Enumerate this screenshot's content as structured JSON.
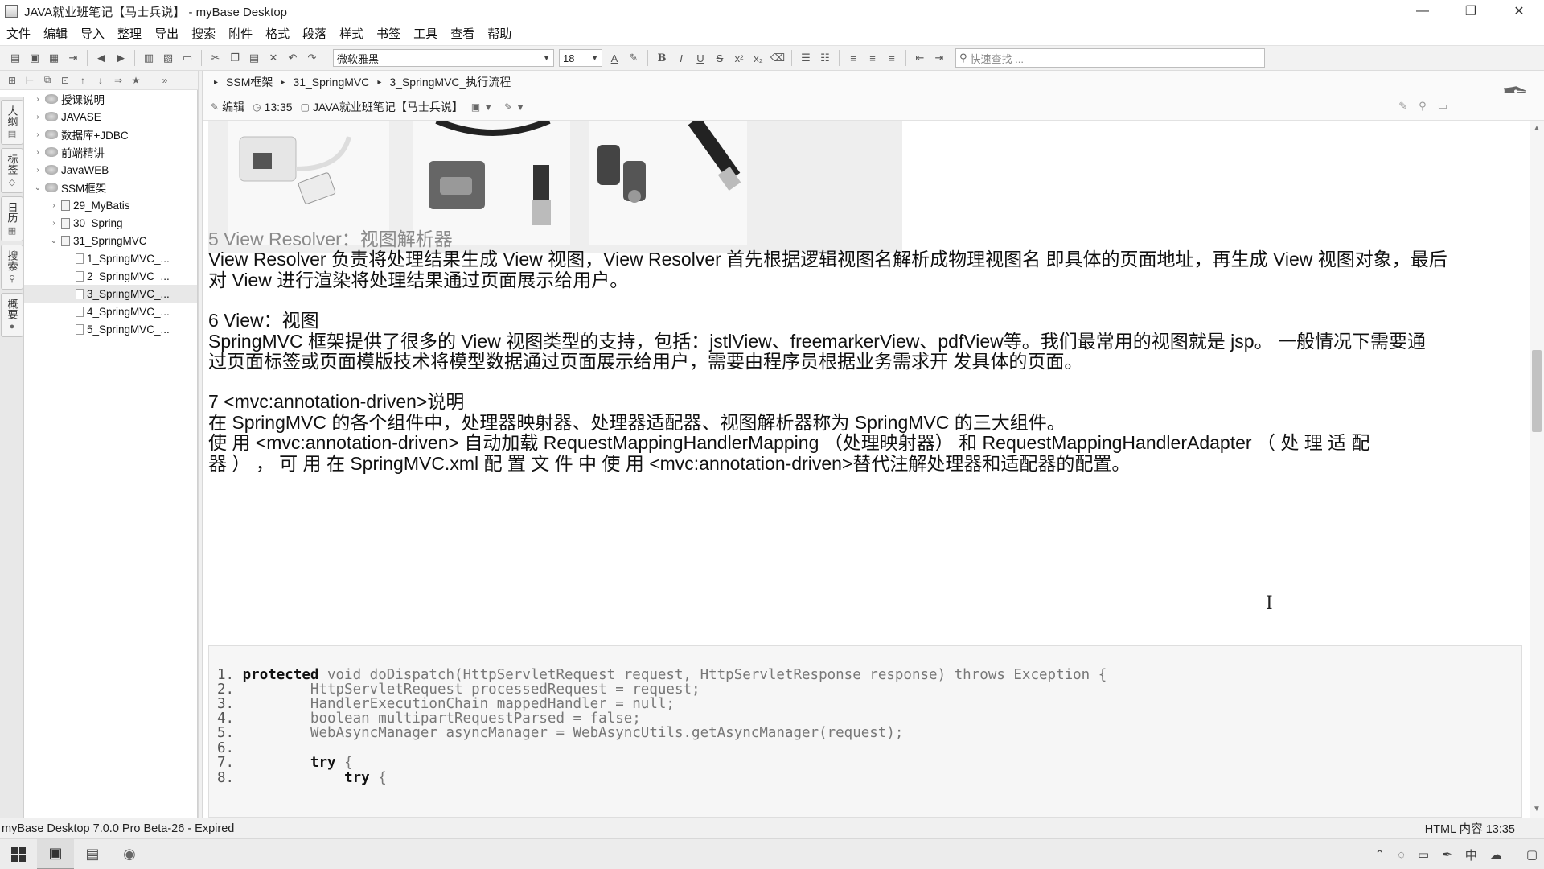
{
  "window": {
    "title": "JAVA就业班笔记【马士兵说】 - myBase Desktop",
    "controls": {
      "minimize": "—",
      "maximize": "❐",
      "close": "✕"
    }
  },
  "menubar": [
    "文件",
    "编辑",
    "导入",
    "整理",
    "导出",
    "搜索",
    "附件",
    "格式",
    "段落",
    "样式",
    "书签",
    "工具",
    "查看",
    "帮助"
  ],
  "toolbar": {
    "font_name": "微软雅黑",
    "font_size": "18",
    "search_placeholder": "快速查找 ..."
  },
  "vertical_tabs": [
    "大纲",
    "标签",
    "日历",
    "搜索",
    "概要"
  ],
  "tree": {
    "nodes": [
      {
        "label": "授课说明",
        "level": 0,
        "expanded": false,
        "icon": "database-icon"
      },
      {
        "label": "JAVASE",
        "level": 0,
        "expanded": false,
        "icon": "database-icon"
      },
      {
        "label": "数据库+JDBC",
        "level": 0,
        "expanded": false,
        "icon": "database-icon"
      },
      {
        "label": "前端精讲",
        "level": 0,
        "expanded": false,
        "icon": "database-icon"
      },
      {
        "label": "JavaWEB",
        "level": 0,
        "expanded": false,
        "icon": "database-icon"
      },
      {
        "label": "SSM框架",
        "level": 0,
        "expanded": true,
        "icon": "database-icon"
      },
      {
        "label": "29_MyBatis",
        "level": 1,
        "expanded": false,
        "icon": "book-icon"
      },
      {
        "label": "30_Spring",
        "level": 1,
        "expanded": false,
        "icon": "book-icon"
      },
      {
        "label": "31_SpringMVC",
        "level": 1,
        "expanded": true,
        "icon": "book-icon"
      },
      {
        "label": "1_SpringMVC_...",
        "level": 2,
        "icon": "page-icon"
      },
      {
        "label": "2_SpringMVC_...",
        "level": 2,
        "icon": "page-icon"
      },
      {
        "label": "3_SpringMVC_...",
        "level": 2,
        "icon": "page-icon",
        "selected": true
      },
      {
        "label": "4_SpringMVC_...",
        "level": 2,
        "icon": "page-icon"
      },
      {
        "label": "5_SpringMVC_...",
        "level": 2,
        "icon": "page-icon"
      }
    ]
  },
  "breadcrumb": [
    "SSM框架",
    "31_SpringMVC",
    "3_SpringMVC_执行流程"
  ],
  "infobar": {
    "mode": "编辑",
    "time": "13:35",
    "database": "JAVA就业班笔记【马士兵说】"
  },
  "content": {
    "s5_heading": "5 View Resolver：视图解析器",
    "s5_body_1": "View Resolver 负责将处理结果生成 View 视图，View Resolver 首先根据逻辑视图名解析成物理视图名 即具体的页面地址，再生成 View 视图对象，最后",
    "s5_body_2": "对 View 进行渲染将处理结果通过页面展示给用户。",
    "s6_heading": "6 View：视图",
    "s6_body_1": "SpringMVC 框架提供了很多的 View 视图类型的支持，包括：jstlView、freemarkerView、pdfView等。我们最常用的视图就是 jsp。 一般情况下需要通",
    "s6_body_2": "过页面标签或页面模版技术将模型数据通过页面展示给用户，需要由程序员根据业务需求开 发具体的页面。",
    "s7_heading": "7 <mvc:annotation-driven>说明",
    "s7_body_1": "在 SpringMVC 的各个组件中，处理器映射器、处理器适配器、视图解析器称为 SpringMVC 的三大组件。",
    "s7_body_2": "使 用 <mvc:annotation-driven> 自动加载 RequestMappingHandlerMapping （处理映射器） 和 RequestMappingHandlerAdapter （ 处 理 适 配",
    "s7_body_3": "器 ） ， 可 用 在 SpringMVC.xml 配 置 文 件 中 使 用 <mvc:annotation-driven>替代注解处理器和适配器的配置。"
  },
  "code": [
    {
      "n": "1.",
      "kw": "protected",
      "rest": " void doDispatch(HttpServletRequest request, HttpServletResponse response) throws Exception {"
    },
    {
      "n": "2.",
      "kw": "",
      "rest": "        HttpServletRequest processedRequest = request;"
    },
    {
      "n": "3.",
      "kw": "",
      "rest": "        HandlerExecutionChain mappedHandler = null;"
    },
    {
      "n": "4.",
      "kw": "",
      "rest": "        boolean multipartRequestParsed = false;"
    },
    {
      "n": "5.",
      "kw": "",
      "rest": "        WebAsyncManager asyncManager = WebAsyncUtils.getAsyncManager(request);"
    },
    {
      "n": "6.",
      "kw": "",
      "rest": ""
    },
    {
      "n": "7.",
      "kw": "try",
      "rest": " {",
      "indent": "        "
    },
    {
      "n": "8.",
      "kw": "try",
      "rest": " {",
      "indent": "            "
    }
  ],
  "statusbar": {
    "left": "myBase Desktop 7.0.0 Pro Beta-26 - Expired",
    "right": "HTML 内容  13:35"
  },
  "taskbar": {
    "tray_ime": "中"
  }
}
